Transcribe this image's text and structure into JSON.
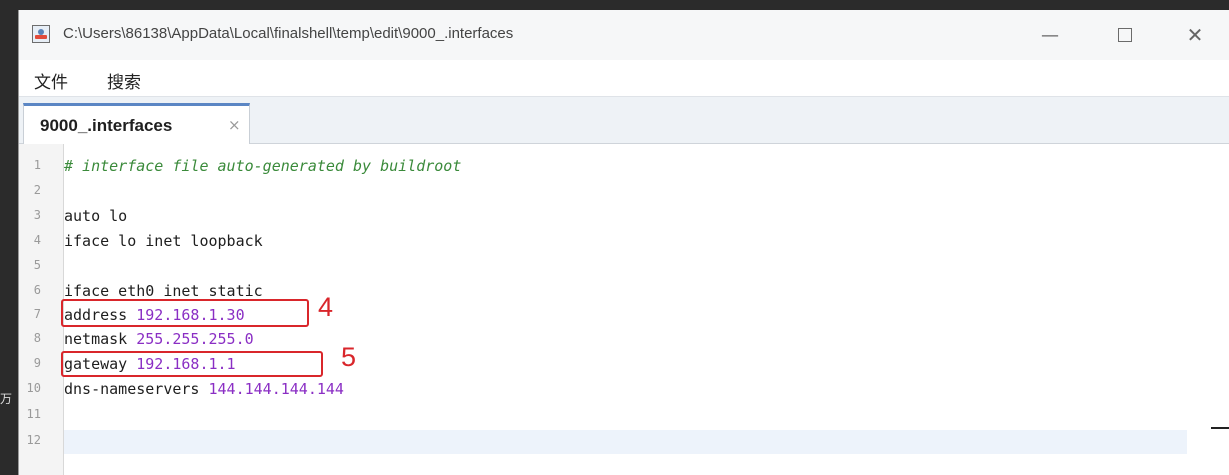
{
  "window": {
    "title": "C:\\Users\\86138\\AppData\\Local\\finalshell\\temp\\edit\\9000_.interfaces",
    "minimize": "—",
    "close": "✕"
  },
  "menu": {
    "file": "文件",
    "search": "搜索"
  },
  "tab": {
    "label": "9000_.interfaces",
    "close": "×"
  },
  "editor": {
    "lines": [
      {
        "n": "1",
        "text": "# interface file auto-generated by buildroot"
      },
      {
        "n": "2",
        "text": ""
      },
      {
        "n": "3",
        "text": "auto lo"
      },
      {
        "n": "4",
        "text": "iface lo inet loopback"
      },
      {
        "n": "5",
        "text": ""
      },
      {
        "n": "6",
        "text": "iface eth0 inet static"
      },
      {
        "n": "7",
        "key": "address",
        "value": "192.168.1.30"
      },
      {
        "n": "8",
        "key": "netmask",
        "value": "255.255.255.0"
      },
      {
        "n": "9",
        "key": "gateway",
        "value": "192.168.1.1"
      },
      {
        "n": "10",
        "key": "dns-nameservers",
        "value": "144.144.144.144"
      },
      {
        "n": "11",
        "text": ""
      },
      {
        "n": "12",
        "text": ""
      }
    ]
  },
  "annotations": {
    "address_marker": "4",
    "gateway_marker": "5"
  },
  "colors": {
    "comment": "#3a8a3a",
    "value": "#8a2ec4",
    "annotation": "#d9262b",
    "tab_accent": "#5b86c4"
  },
  "background_fragment": "万"
}
